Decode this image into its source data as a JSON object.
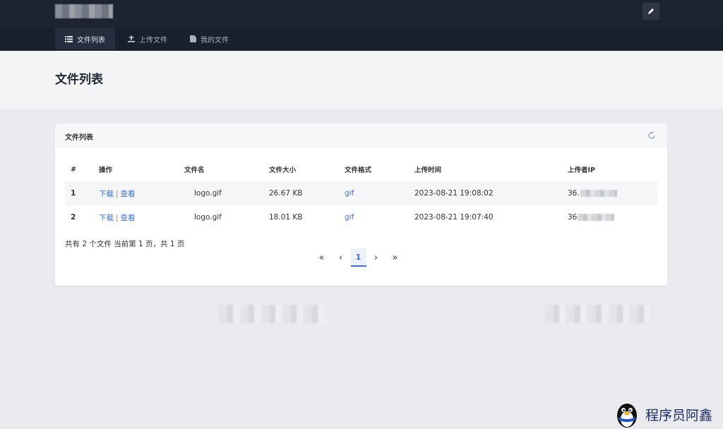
{
  "navbar": {
    "tabs": [
      {
        "label": "文件列表",
        "icon": "list-icon",
        "active": true
      },
      {
        "label": "上传文件",
        "icon": "upload-icon",
        "active": false
      },
      {
        "label": "我的文件",
        "icon": "file-icon",
        "active": false
      }
    ]
  },
  "page": {
    "title": "文件列表"
  },
  "card": {
    "title": "文件列表",
    "columns": [
      "#",
      "操作",
      "文件名",
      "文件大小",
      "文件格式",
      "上传时间",
      "上传者IP"
    ],
    "rows": [
      {
        "index": "1",
        "download": "下载",
        "view": "查看",
        "name": "logo.gif",
        "size": "26.67 KB",
        "format": "gif",
        "time": "2023-08-21 19:08:02",
        "ip": "36."
      },
      {
        "index": "2",
        "download": "下载",
        "view": "查看",
        "name": "logo.gif",
        "size": "18.01 KB",
        "format": "gif",
        "time": "2023-08-21 19:07:40",
        "ip": "36"
      }
    ],
    "summary": "共有 2 个文件  当前第 1 页，共 1 页",
    "pagination": {
      "first": "«",
      "prev": "‹",
      "current": "1",
      "next": "›",
      "last": "»"
    }
  },
  "badge": {
    "text": "程序员阿鑫"
  },
  "colors": {
    "navbar": "#1c2331",
    "link": "#3b6fd6",
    "background": "#e9ebef"
  }
}
